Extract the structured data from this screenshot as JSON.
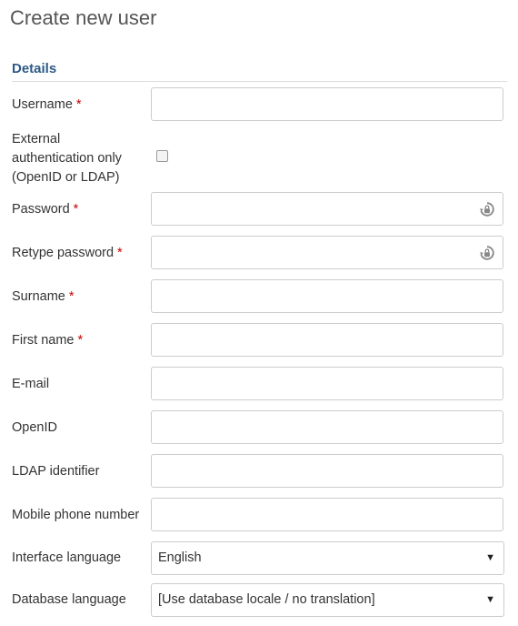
{
  "page": {
    "title": "Create new user"
  },
  "section": {
    "details_label": "Details"
  },
  "required_marker": "*",
  "fields": {
    "username": {
      "label": "Username",
      "value": ""
    },
    "external_auth": {
      "label_line1": "External",
      "label_line2": "authentication only",
      "label_line3": "(OpenID or LDAP)",
      "checked": false
    },
    "password": {
      "label": "Password",
      "value": ""
    },
    "retype_password": {
      "label": "Retype password",
      "value": ""
    },
    "surname": {
      "label": "Surname",
      "value": ""
    },
    "first_name": {
      "label": "First name",
      "value": ""
    },
    "email": {
      "label": "E-mail",
      "value": ""
    },
    "openid": {
      "label": "OpenID",
      "value": ""
    },
    "ldap": {
      "label": "LDAP identifier",
      "value": ""
    },
    "mobile": {
      "label": "Mobile phone number",
      "value": ""
    },
    "interface_language": {
      "label": "Interface language",
      "selected": "English"
    },
    "database_language": {
      "label": "Database language",
      "selected": "[Use database locale / no translation]"
    }
  },
  "icons": {
    "password_generate": "password-generate-icon",
    "dropdown": "chevron-down-icon"
  },
  "colors": {
    "title": "#555555",
    "section_header": "#2e5a87",
    "required": "#cc0000",
    "input_border": "#cccccc"
  }
}
